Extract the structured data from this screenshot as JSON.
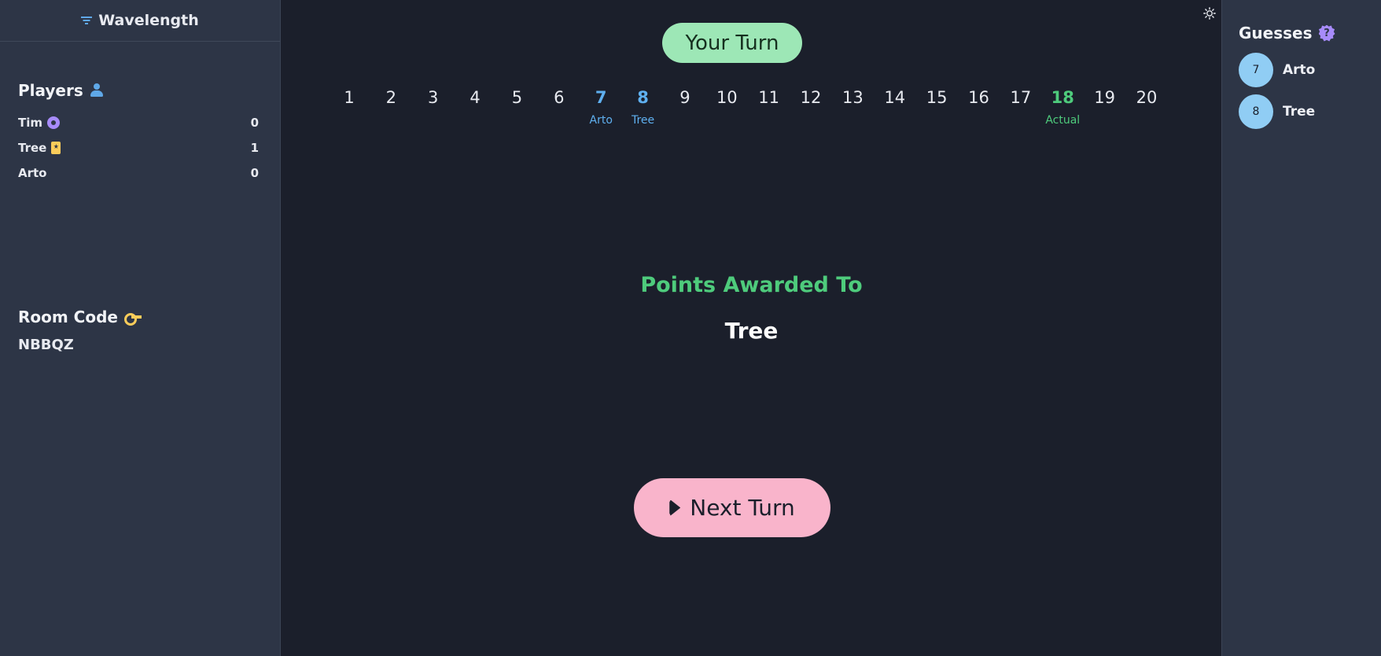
{
  "app": {
    "title": "Wavelength"
  },
  "players_section": {
    "title": "Players",
    "players": [
      {
        "name": "Tim",
        "score": "0",
        "icon": "target-icon"
      },
      {
        "name": "Tree",
        "score": "1",
        "icon": "bookmark-star-icon"
      },
      {
        "name": "Arto",
        "score": "0",
        "icon": ""
      }
    ]
  },
  "room": {
    "title": "Room Code",
    "code": "NBBQZ"
  },
  "turn": {
    "label": "Your Turn"
  },
  "scale": {
    "numbers": [
      "1",
      "2",
      "3",
      "4",
      "5",
      "6",
      "7",
      "8",
      "9",
      "10",
      "11",
      "12",
      "13",
      "14",
      "15",
      "16",
      "17",
      "18",
      "19",
      "20"
    ],
    "markers": {
      "7": "Arto",
      "8": "Tree",
      "18": "Actual"
    },
    "colors": {
      "guess": "#5fb0f0",
      "actual": "#4ecb7c"
    }
  },
  "result": {
    "label": "Points Awarded To",
    "winner": "Tree"
  },
  "next_button": {
    "label": "Next Turn"
  },
  "guesses": {
    "title": "Guesses",
    "items": [
      {
        "value": "7",
        "name": "Arto"
      },
      {
        "value": "8",
        "name": "Tree"
      }
    ]
  },
  "colors": {
    "background": "#1b1f2b",
    "panel": "#2d3546",
    "turn_pill": "#9de7b6",
    "next_button": "#f9b4cb",
    "accent_green": "#4ecb7c",
    "accent_blue": "#5fb0f0",
    "accent_purple": "#a78bfa",
    "accent_yellow": "#facc5a"
  }
}
